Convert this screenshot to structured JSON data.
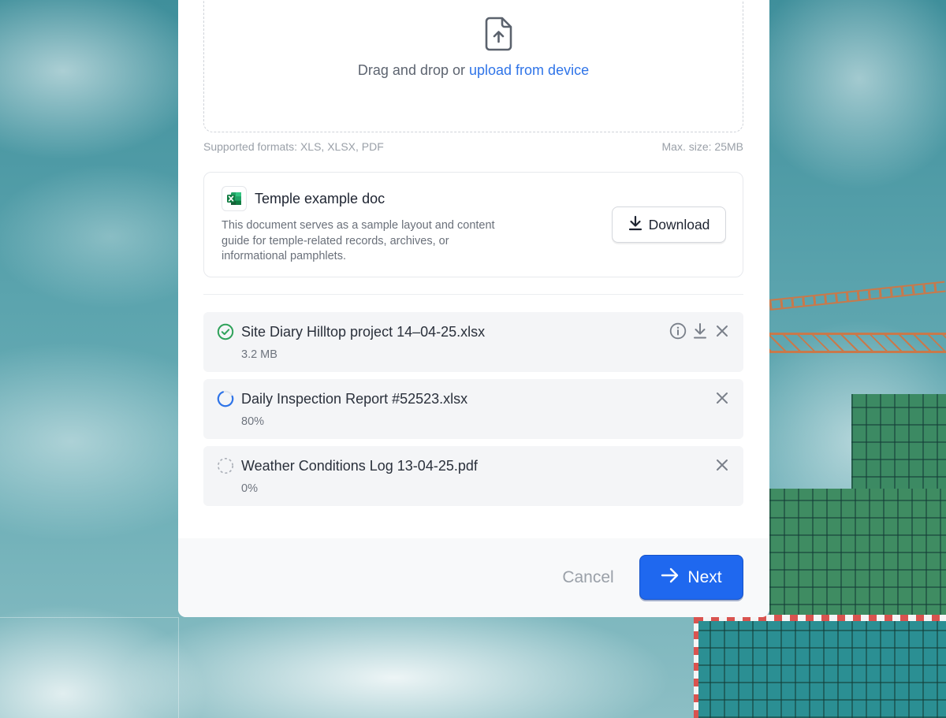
{
  "dropzone": {
    "text": "Drag and drop or ",
    "link": "upload from device",
    "icon": "file-upload-icon"
  },
  "hints": {
    "formats": "Supported formats: XLS, XLSX, PDF",
    "max_size": "Max. size: 25MB"
  },
  "template": {
    "icon": "excel-icon",
    "title": "Temple example doc",
    "description": "This document serves as a sample layout and content guide for temple-related records, archives, or informational pamphlets.",
    "download_label": "Download"
  },
  "files": [
    {
      "name": "Site Diary Hilltop project 14–04-25.xlsx",
      "meta": "3.2 MB",
      "status": "completed",
      "status_icon": "check-circle-icon",
      "actions": [
        "info-icon",
        "download-icon",
        "close-icon"
      ]
    },
    {
      "name": "Daily Inspection Report #52523.xlsx",
      "meta": "80%",
      "status": "uploading",
      "progress": 0.8,
      "status_icon": "spinner-icon",
      "actions": [
        "close-icon"
      ]
    },
    {
      "name": "Weather Conditions Log 13-04-25.pdf",
      "meta": "0%",
      "status": "pending",
      "progress": 0,
      "status_icon": "dashed-circle-icon",
      "actions": [
        "close-icon"
      ]
    }
  ],
  "footer": {
    "cancel_label": "Cancel",
    "next_label": "Next"
  },
  "colors": {
    "accent": "#1f68ef",
    "link": "#2f74e8",
    "success": "#2fa25a"
  }
}
